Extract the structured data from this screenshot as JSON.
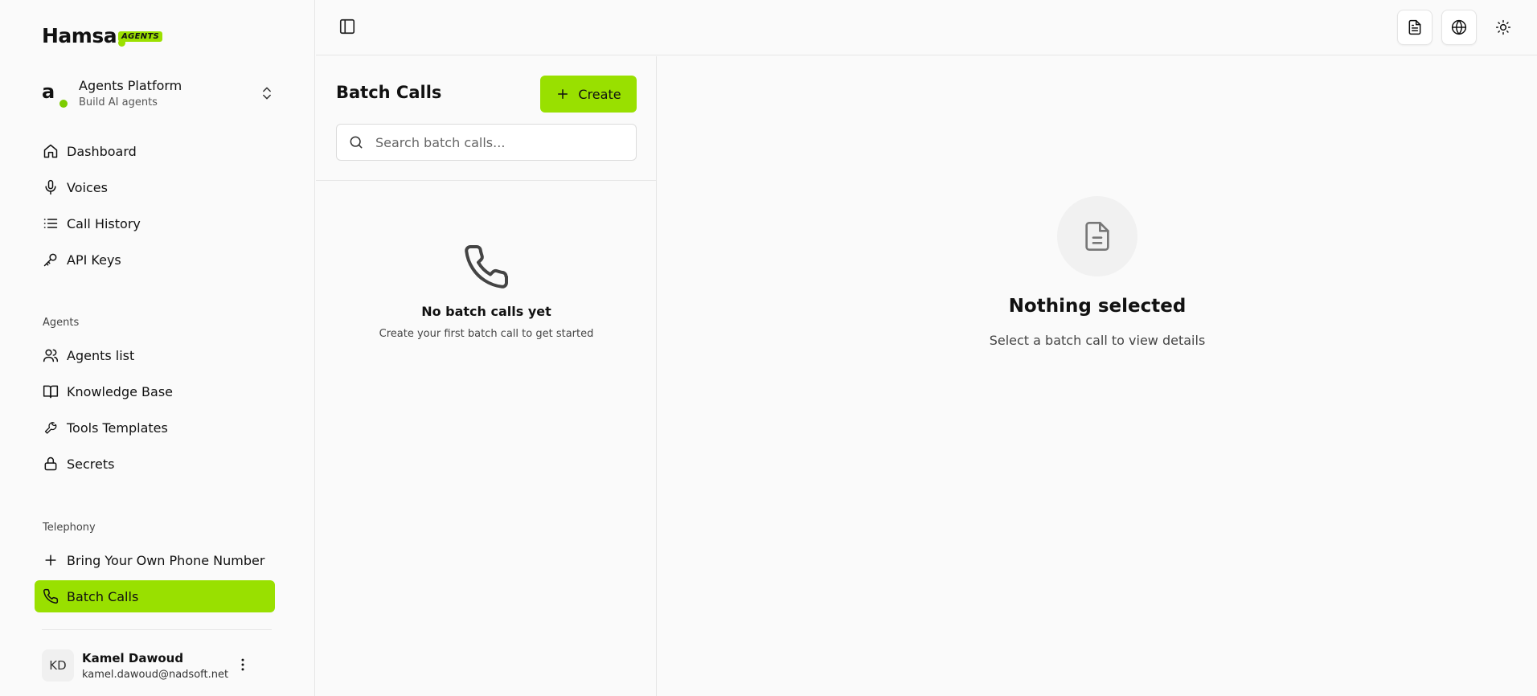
{
  "brand": {
    "name": "Hamsa",
    "badge": "AGENTS",
    "accent": "#99e000"
  },
  "workspace": {
    "title": "Agents Platform",
    "subtitle": "Build AI agents",
    "avatar_letter": "a"
  },
  "nav_main": [
    {
      "label": "Dashboard",
      "icon": "home-icon"
    },
    {
      "label": "Voices",
      "icon": "microphone-icon"
    },
    {
      "label": "Call History",
      "icon": "list-icon"
    },
    {
      "label": "API Keys",
      "icon": "key-icon"
    }
  ],
  "sections": {
    "agents": "Agents",
    "telephony": "Telephony"
  },
  "nav_agents": [
    {
      "label": "Agents list",
      "icon": "users-icon"
    },
    {
      "label": "Knowledge Base",
      "icon": "book-icon"
    },
    {
      "label": "Tools Templates",
      "icon": "wrench-icon"
    },
    {
      "label": "Secrets",
      "icon": "lock-icon"
    }
  ],
  "nav_telephony": [
    {
      "label": "Bring Your Own Phone Number",
      "icon": "plus-icon"
    },
    {
      "label": "Batch Calls",
      "icon": "phone-icon",
      "active": true
    }
  ],
  "user": {
    "initials": "KD",
    "name": "Kamel Dawoud",
    "email": "kamel.dawoud@nadsoft.net"
  },
  "batch_list": {
    "title": "Batch Calls",
    "create_label": "Create",
    "search_placeholder": "Search batch calls...",
    "empty_title": "No batch calls yet",
    "empty_subtitle": "Create your first batch call to get started"
  },
  "detail": {
    "empty_title": "Nothing selected",
    "empty_subtitle": "Select a batch call to view details"
  }
}
